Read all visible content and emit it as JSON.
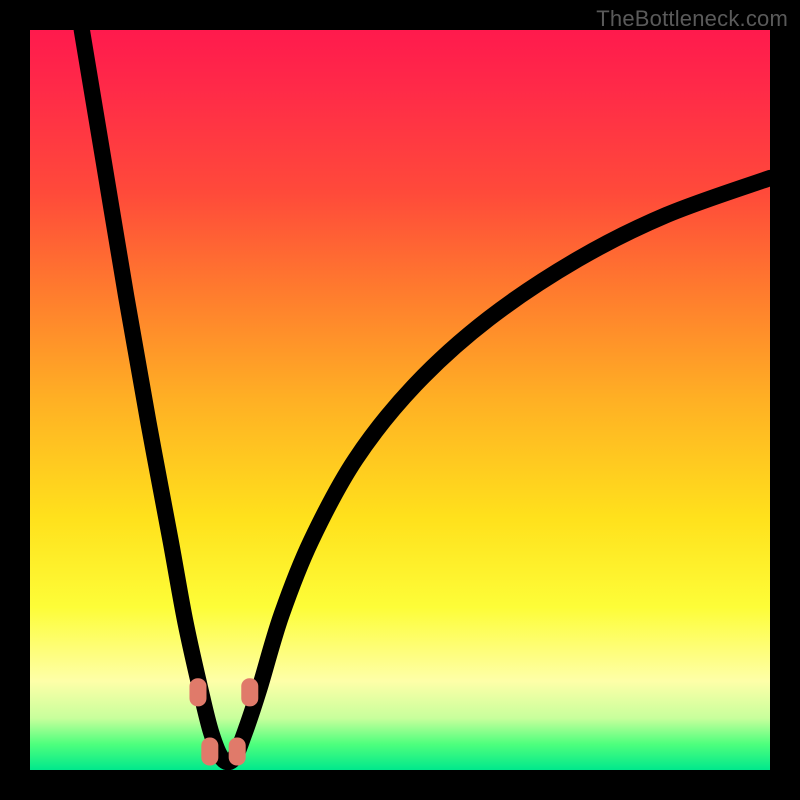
{
  "watermark": "TheBottleneck.com",
  "chart_data": {
    "type": "line",
    "title": "",
    "xlabel": "",
    "ylabel": "",
    "xlim": [
      0,
      100
    ],
    "ylim": [
      0,
      100
    ],
    "grid": false,
    "legend": false,
    "description": "V-shaped bottleneck curve plotted over a vertical red-to-green gradient background. X axis is an implicit hardware/config scale; Y axis is bottleneck percentage (top is high, bottom is near-zero). The curve dives steeply from the top-left to a floor around x≈26 where bottleneck ≈0, then rises asymptotically toward the right.",
    "series": [
      {
        "name": "bottleneck-curve",
        "x": [
          7,
          10,
          13,
          16,
          19,
          21,
          23,
          24.5,
          26,
          27.5,
          29,
          31,
          34,
          38,
          44,
          52,
          62,
          74,
          86,
          100
        ],
        "values": [
          100,
          82,
          64,
          47,
          31,
          20,
          11,
          5,
          1.5,
          1.5,
          5,
          11,
          21,
          31,
          42,
          52,
          61,
          69,
          75,
          80
        ]
      }
    ],
    "markers": [
      {
        "x": 22.7,
        "y": 10.5
      },
      {
        "x": 29.7,
        "y": 10.5
      },
      {
        "x": 24.3,
        "y": 2.5
      },
      {
        "x": 28.0,
        "y": 2.5
      }
    ],
    "marker_style": {
      "shape": "rounded-rect",
      "color": "#e07a6a",
      "w": 2.3,
      "h": 3.8,
      "rx": 1.1
    }
  }
}
